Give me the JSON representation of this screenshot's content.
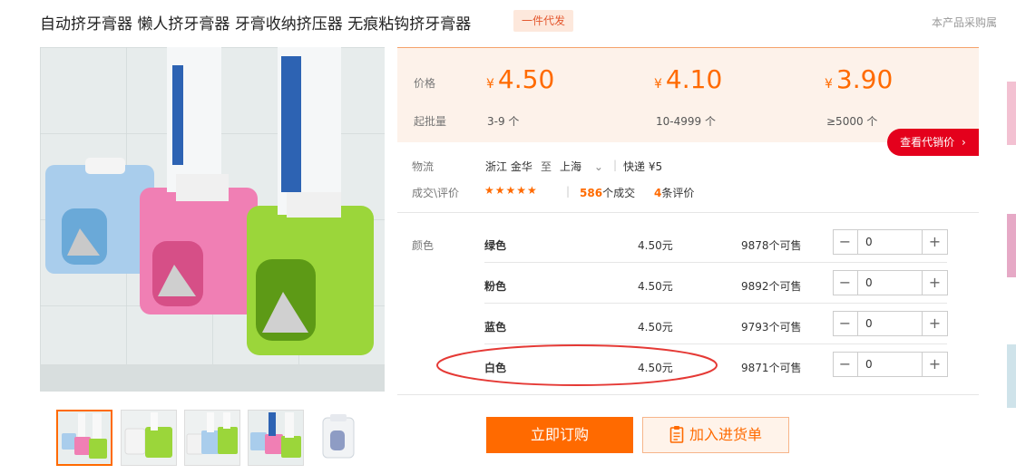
{
  "product": {
    "title": "自动挤牙膏器 懒人挤牙膏器 牙膏收纳挤压器 无痕粘钩挤牙膏器",
    "tag": "一件代发",
    "top_right_text": "本产品采购属"
  },
  "gallery": {
    "thumbnail_count": 5
  },
  "pricing": {
    "price_label": "价格",
    "moq_label": "起批量",
    "currency_symbol": "¥",
    "tiers": [
      {
        "price": "4.50",
        "range": "3-9 个"
      },
      {
        "price": "4.10",
        "range": "10-4999 个"
      },
      {
        "price": "3.90",
        "range": "≥5000 个"
      }
    ],
    "view_button": "查看代销价"
  },
  "logistics": {
    "label": "物流",
    "origin": "浙江 金华",
    "to_word": "至",
    "destination": "上海",
    "shipping": "快递 ¥5"
  },
  "reviews": {
    "label": "成交\\评价",
    "stars": "★★★★★",
    "deals_count": "586",
    "deals_suffix": "个成交",
    "reviews_count": "4",
    "reviews_suffix": "条评价"
  },
  "variants": {
    "label": "颜色",
    "rows": [
      {
        "name": "绿色",
        "price": "4.50元",
        "stock": "9878个可售",
        "qty": "0"
      },
      {
        "name": "粉色",
        "price": "4.50元",
        "stock": "9892个可售",
        "qty": "0"
      },
      {
        "name": "蓝色",
        "price": "4.50元",
        "stock": "9793个可售",
        "qty": "0"
      },
      {
        "name": "白色",
        "price": "4.50元",
        "stock": "9871个可售",
        "qty": "0"
      }
    ]
  },
  "actions": {
    "buy_now": "立即订购",
    "add_to_list": "加入进货单"
  },
  "colors": {
    "accent": "#ff6a00",
    "red": "#e4001c",
    "highlight_ellipse": "#e53935"
  }
}
